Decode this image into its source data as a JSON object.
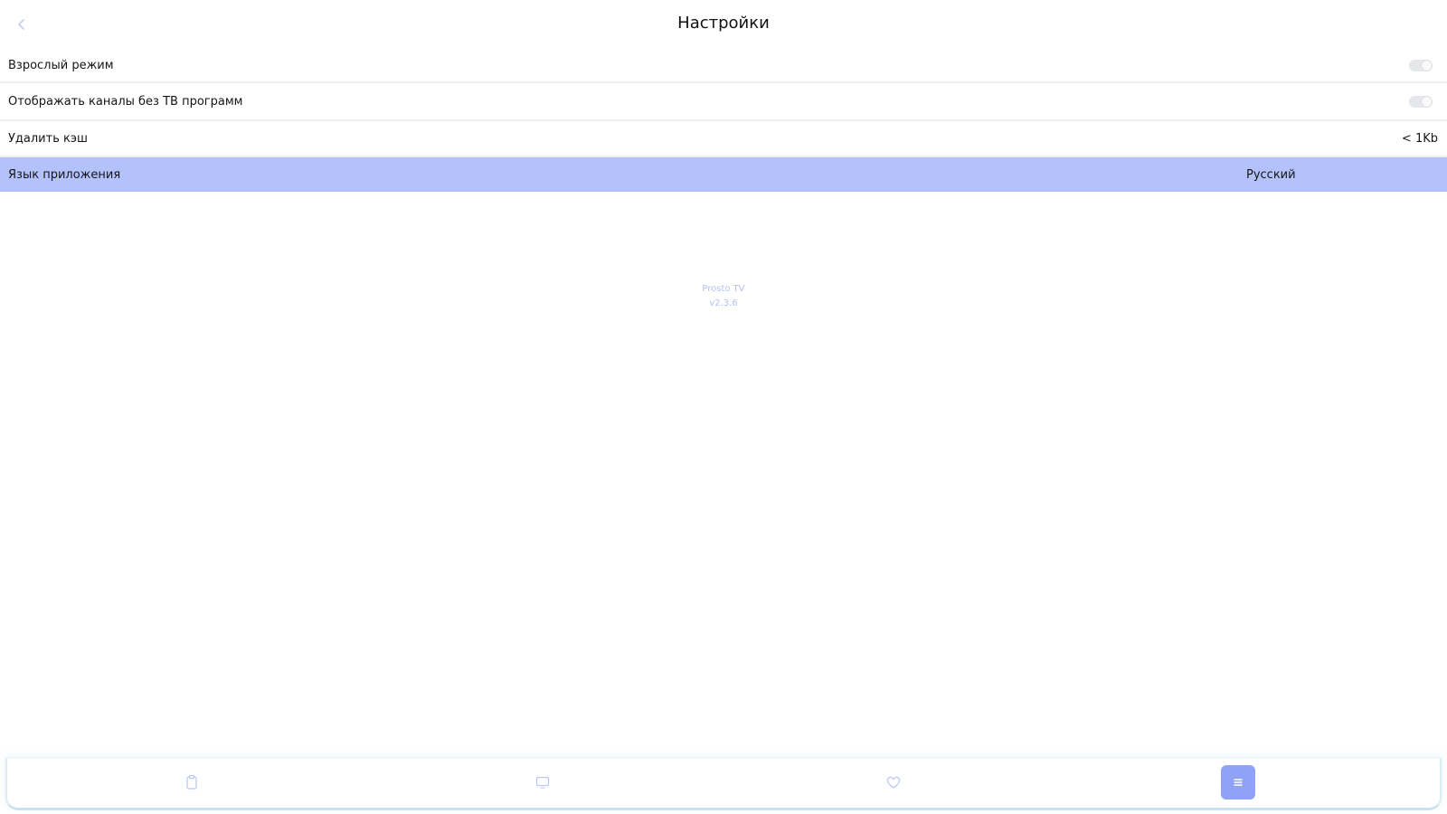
{
  "header": {
    "title": "Настройки",
    "back_icon": "chevron-left-icon"
  },
  "settings": [
    {
      "label": "Взрослый режим",
      "control": "toggle",
      "on": false
    },
    {
      "label": "Отображать каналы без ТВ программ",
      "control": "toggle",
      "on": false
    },
    {
      "label": "Удалить кэш",
      "value": "< 1Kb"
    },
    {
      "label": "Язык приложения",
      "value": "Русский",
      "selected": true
    }
  ],
  "app_info": {
    "name": "Prosto TV",
    "version": "v2.3.6"
  },
  "bottom_nav": {
    "items": [
      {
        "icon": "clipboard-icon",
        "active": false
      },
      {
        "icon": "tv-icon",
        "active": false
      },
      {
        "icon": "heart-icon",
        "active": false
      },
      {
        "icon": "settings-list-icon",
        "active": true
      }
    ]
  },
  "colors": {
    "accent": "#8fa2f7",
    "selected_row": "#b4c2fb",
    "muted_text": "#b4c1f3",
    "divider": "#eceef2"
  }
}
